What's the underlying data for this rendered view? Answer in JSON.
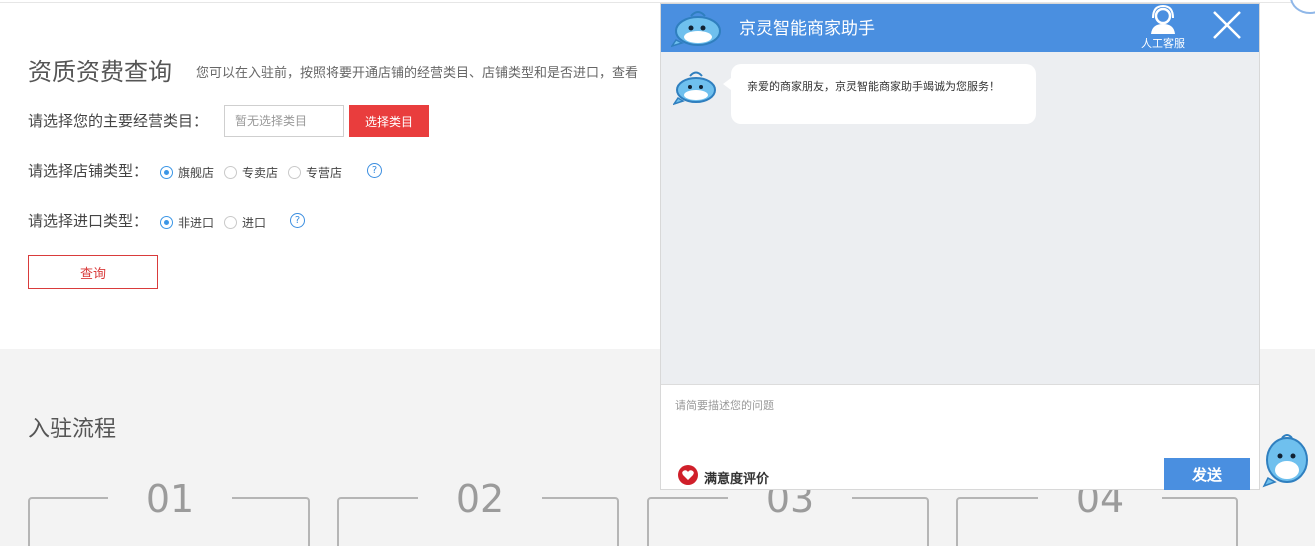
{
  "query": {
    "title": "资质资费查询",
    "description": "您可以在入驻前，按照将要开通店铺的经营类目、店铺类型和是否进口，查看",
    "category_label": "请选择您的主要经营类目：",
    "category_placeholder": "暂无选择类目",
    "select_category_button": "选择类目",
    "store_type_label": "请选择店铺类型：",
    "store_types": [
      {
        "label": "旗舰店",
        "checked": true
      },
      {
        "label": "专卖店",
        "checked": false
      },
      {
        "label": "专营店",
        "checked": false
      }
    ],
    "import_type_label": "请选择进口类型：",
    "import_types": [
      {
        "label": "非进口",
        "checked": true
      },
      {
        "label": "进口",
        "checked": false
      }
    ],
    "help_symbol": "?",
    "query_button": "查询"
  },
  "process": {
    "title": "入驻流程",
    "steps": [
      {
        "number": "01"
      },
      {
        "number": "02"
      },
      {
        "number": "03"
      },
      {
        "number": "04"
      }
    ]
  },
  "chat": {
    "title": "京灵智能商家助手",
    "agent_label": "人工客服",
    "welcome_message": "亲爱的商家朋友，京灵智能商家助手竭诚为您服务！",
    "input_placeholder": "请简要描述您的问题",
    "rating_label": "满意度评价",
    "send_button": "发送"
  },
  "colors": {
    "accent_red": "#e93d3d",
    "chat_blue": "#4a8fe0",
    "radio_blue": "#3b96e6"
  },
  "icons": {
    "bot": "whale-mascot-icon",
    "agent": "customer-service-icon",
    "close": "close-icon",
    "rating": "heart-icon",
    "help": "question-circle-icon"
  }
}
